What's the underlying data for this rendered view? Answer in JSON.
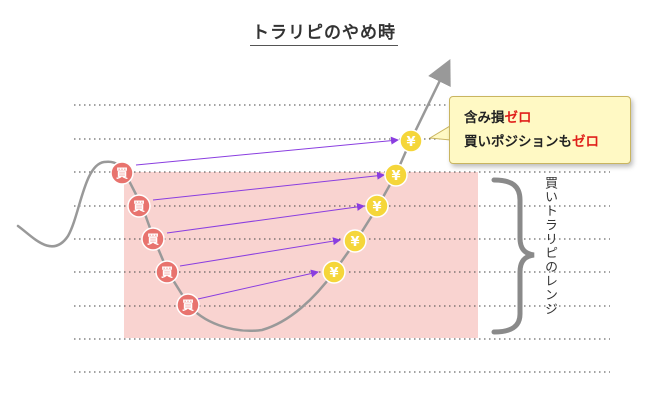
{
  "title": "トラリピのやめ時",
  "buy_marker_label": "買",
  "sell_marker_label": "¥",
  "callout": {
    "line1": "含み損",
    "line1_highlight": "ゼロ",
    "line2": "買いポジションも",
    "line2_highlight": "ゼロ"
  },
  "range_label": "買いトラリピのレンジ",
  "colors": {
    "range_fill": "#f9d3d0",
    "buy_marker": "#e8736e",
    "sell_marker": "#f5d63a",
    "arrow": "#8a3ee0",
    "price_line": "#999999",
    "callout_bg": "#fff9c4",
    "highlight": "#e0201b"
  }
}
